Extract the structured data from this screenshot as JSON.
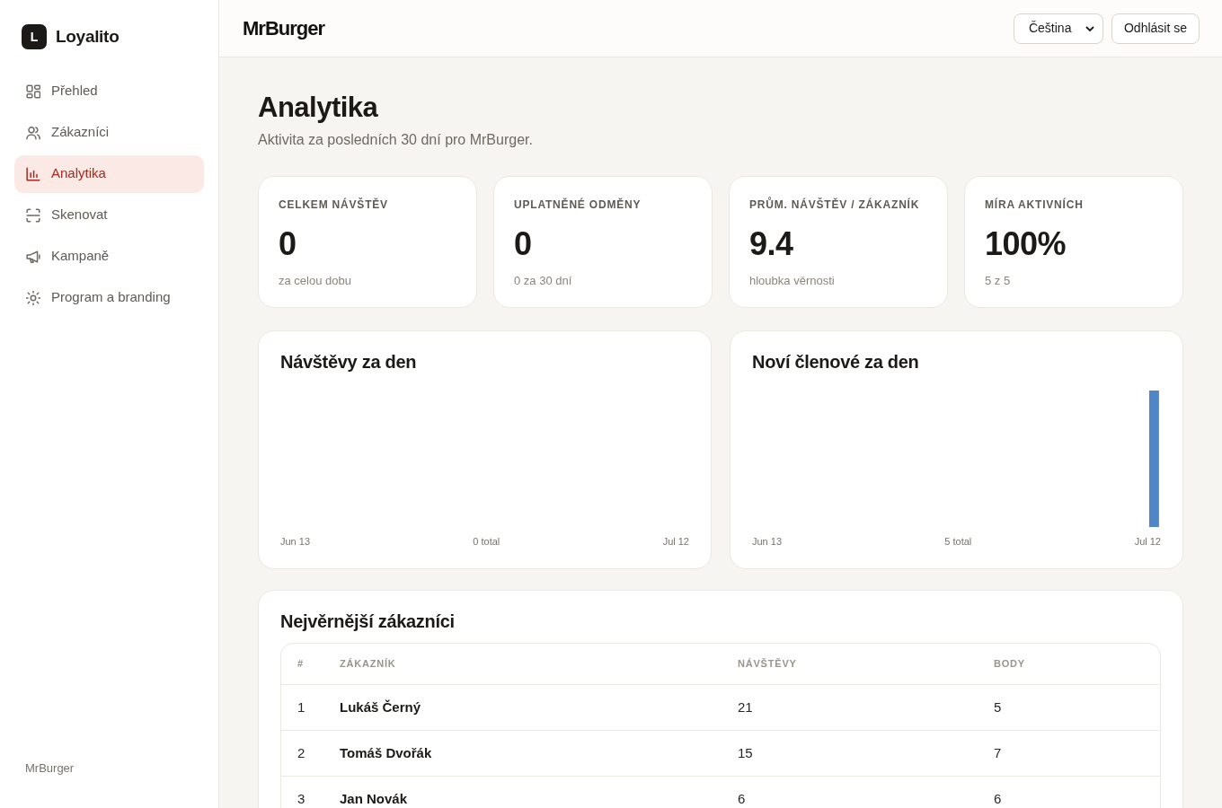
{
  "sidebar": {
    "logo": {
      "mark": "L",
      "name": "Loyalito"
    },
    "items": [
      {
        "label": "Přehled",
        "selected": false
      },
      {
        "label": "Zákazníci",
        "selected": false
      },
      {
        "label": "Analytika",
        "selected": true
      },
      {
        "label": "Skenovat",
        "selected": false
      },
      {
        "label": "Kampaně",
        "selected": false
      },
      {
        "label": "Program a branding",
        "selected": false
      }
    ],
    "footer": "MrBurger"
  },
  "header": {
    "logo": "MrBurger",
    "language": "Čeština",
    "logout": "Odhlásit se"
  },
  "page": {
    "title": "Analytika",
    "subtitle": "Aktivita za posledních 30 dní pro MrBurger."
  },
  "stats": [
    {
      "label": "CELKEM NÁVŠTĚV",
      "value": "0",
      "note": "za celou dobu"
    },
    {
      "label": "UPLATNĚNÉ ODMĚNY",
      "value": "0",
      "note": "0 za 30 dní"
    },
    {
      "label": "PRŮM. NÁVŠTĚV / ZÁKAZNÍK",
      "value": "9.4",
      "note": "hloubka věrnosti"
    },
    {
      "label": "MÍRA AKTIVNÍCH",
      "value": "100%",
      "note": "5 z 5"
    }
  ],
  "charts": [
    {
      "title": "Návštěvy za den",
      "axis_start": "Jun 13",
      "total": "0 total",
      "axis_end": "Jul 12"
    },
    {
      "title": "Noví členové za den",
      "axis_start": "Jun 13",
      "total": "5 total",
      "axis_end": "Jul 12"
    }
  ],
  "top_customers": {
    "title": "Nejvěrnější zákazníci",
    "columns": [
      "#",
      "ZÁKAZNÍK",
      "NÁVŠTĚVY",
      "BODY"
    ],
    "rows": [
      [
        "1",
        "Lukáš Černý",
        "21",
        "5"
      ],
      [
        "2",
        "Tomáš Dvořák",
        "15",
        "7"
      ],
      [
        "3",
        "Jan Novák",
        "6",
        "6"
      ]
    ]
  }
}
